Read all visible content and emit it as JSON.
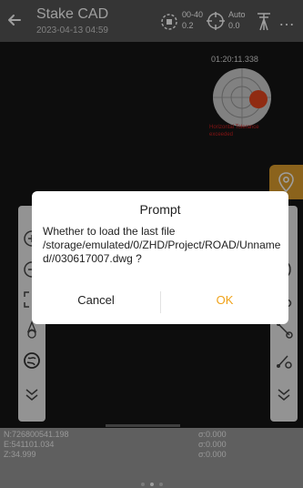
{
  "header": {
    "title": "Stake CAD",
    "datetime": "2023-04-13 04:59",
    "sat_top": "00-40",
    "sat_bottom": "0.2",
    "auto_top": "Auto",
    "auto_bottom": "0.0",
    "more": "…"
  },
  "map": {
    "timer": "01:20:11.338",
    "compass_note": "Horizontal Tolerance exceeded"
  },
  "status": {
    "northing": "N:726800541.198",
    "easting": "E:541101.034",
    "z": "Z:34.999",
    "sigma1": "σ:0.000",
    "sigma2": "σ:0.000",
    "sigma3": "σ:0.000"
  },
  "dialog": {
    "title": "Prompt",
    "message": "Whether to load the last file /storage/emulated/0/ZHD/Project/ROAD/Unnamed//030617007.dwg ?",
    "cancel_label": "Cancel",
    "ok_label": "OK"
  },
  "colors": {
    "accent": "#f0a218",
    "header_bg": "#565656",
    "compass_dot": "#e8461d",
    "status_bg": "#9a9a9a"
  }
}
